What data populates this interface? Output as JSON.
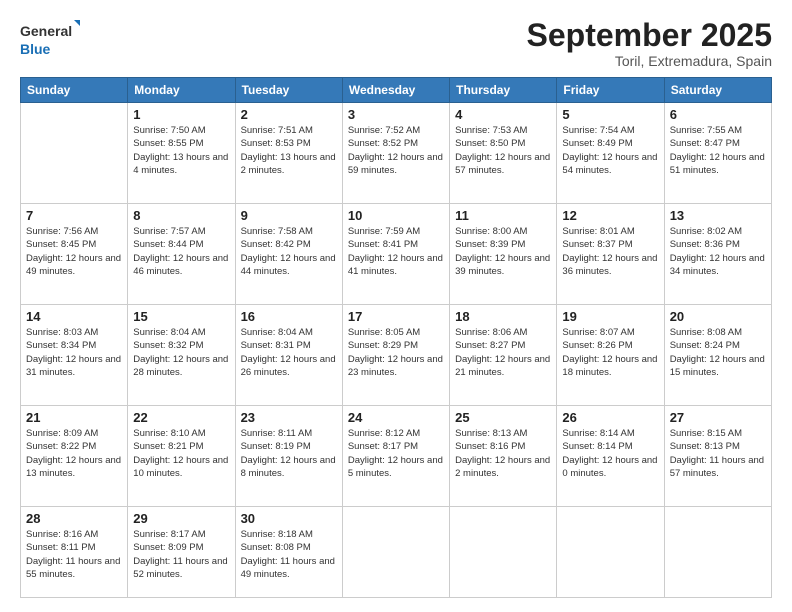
{
  "logo": {
    "line1": "General",
    "line2": "Blue"
  },
  "title": "September 2025",
  "location": "Toril, Extremadura, Spain",
  "weekdays": [
    "Sunday",
    "Monday",
    "Tuesday",
    "Wednesday",
    "Thursday",
    "Friday",
    "Saturday"
  ],
  "weeks": [
    [
      {
        "day": "",
        "sunrise": "",
        "sunset": "",
        "daylight": ""
      },
      {
        "day": "1",
        "sunrise": "Sunrise: 7:50 AM",
        "sunset": "Sunset: 8:55 PM",
        "daylight": "Daylight: 13 hours and 4 minutes."
      },
      {
        "day": "2",
        "sunrise": "Sunrise: 7:51 AM",
        "sunset": "Sunset: 8:53 PM",
        "daylight": "Daylight: 13 hours and 2 minutes."
      },
      {
        "day": "3",
        "sunrise": "Sunrise: 7:52 AM",
        "sunset": "Sunset: 8:52 PM",
        "daylight": "Daylight: 12 hours and 59 minutes."
      },
      {
        "day": "4",
        "sunrise": "Sunrise: 7:53 AM",
        "sunset": "Sunset: 8:50 PM",
        "daylight": "Daylight: 12 hours and 57 minutes."
      },
      {
        "day": "5",
        "sunrise": "Sunrise: 7:54 AM",
        "sunset": "Sunset: 8:49 PM",
        "daylight": "Daylight: 12 hours and 54 minutes."
      },
      {
        "day": "6",
        "sunrise": "Sunrise: 7:55 AM",
        "sunset": "Sunset: 8:47 PM",
        "daylight": "Daylight: 12 hours and 51 minutes."
      }
    ],
    [
      {
        "day": "7",
        "sunrise": "Sunrise: 7:56 AM",
        "sunset": "Sunset: 8:45 PM",
        "daylight": "Daylight: 12 hours and 49 minutes."
      },
      {
        "day": "8",
        "sunrise": "Sunrise: 7:57 AM",
        "sunset": "Sunset: 8:44 PM",
        "daylight": "Daylight: 12 hours and 46 minutes."
      },
      {
        "day": "9",
        "sunrise": "Sunrise: 7:58 AM",
        "sunset": "Sunset: 8:42 PM",
        "daylight": "Daylight: 12 hours and 44 minutes."
      },
      {
        "day": "10",
        "sunrise": "Sunrise: 7:59 AM",
        "sunset": "Sunset: 8:41 PM",
        "daylight": "Daylight: 12 hours and 41 minutes."
      },
      {
        "day": "11",
        "sunrise": "Sunrise: 8:00 AM",
        "sunset": "Sunset: 8:39 PM",
        "daylight": "Daylight: 12 hours and 39 minutes."
      },
      {
        "day": "12",
        "sunrise": "Sunrise: 8:01 AM",
        "sunset": "Sunset: 8:37 PM",
        "daylight": "Daylight: 12 hours and 36 minutes."
      },
      {
        "day": "13",
        "sunrise": "Sunrise: 8:02 AM",
        "sunset": "Sunset: 8:36 PM",
        "daylight": "Daylight: 12 hours and 34 minutes."
      }
    ],
    [
      {
        "day": "14",
        "sunrise": "Sunrise: 8:03 AM",
        "sunset": "Sunset: 8:34 PM",
        "daylight": "Daylight: 12 hours and 31 minutes."
      },
      {
        "day": "15",
        "sunrise": "Sunrise: 8:04 AM",
        "sunset": "Sunset: 8:32 PM",
        "daylight": "Daylight: 12 hours and 28 minutes."
      },
      {
        "day": "16",
        "sunrise": "Sunrise: 8:04 AM",
        "sunset": "Sunset: 8:31 PM",
        "daylight": "Daylight: 12 hours and 26 minutes."
      },
      {
        "day": "17",
        "sunrise": "Sunrise: 8:05 AM",
        "sunset": "Sunset: 8:29 PM",
        "daylight": "Daylight: 12 hours and 23 minutes."
      },
      {
        "day": "18",
        "sunrise": "Sunrise: 8:06 AM",
        "sunset": "Sunset: 8:27 PM",
        "daylight": "Daylight: 12 hours and 21 minutes."
      },
      {
        "day": "19",
        "sunrise": "Sunrise: 8:07 AM",
        "sunset": "Sunset: 8:26 PM",
        "daylight": "Daylight: 12 hours and 18 minutes."
      },
      {
        "day": "20",
        "sunrise": "Sunrise: 8:08 AM",
        "sunset": "Sunset: 8:24 PM",
        "daylight": "Daylight: 12 hours and 15 minutes."
      }
    ],
    [
      {
        "day": "21",
        "sunrise": "Sunrise: 8:09 AM",
        "sunset": "Sunset: 8:22 PM",
        "daylight": "Daylight: 12 hours and 13 minutes."
      },
      {
        "day": "22",
        "sunrise": "Sunrise: 8:10 AM",
        "sunset": "Sunset: 8:21 PM",
        "daylight": "Daylight: 12 hours and 10 minutes."
      },
      {
        "day": "23",
        "sunrise": "Sunrise: 8:11 AM",
        "sunset": "Sunset: 8:19 PM",
        "daylight": "Daylight: 12 hours and 8 minutes."
      },
      {
        "day": "24",
        "sunrise": "Sunrise: 8:12 AM",
        "sunset": "Sunset: 8:17 PM",
        "daylight": "Daylight: 12 hours and 5 minutes."
      },
      {
        "day": "25",
        "sunrise": "Sunrise: 8:13 AM",
        "sunset": "Sunset: 8:16 PM",
        "daylight": "Daylight: 12 hours and 2 minutes."
      },
      {
        "day": "26",
        "sunrise": "Sunrise: 8:14 AM",
        "sunset": "Sunset: 8:14 PM",
        "daylight": "Daylight: 12 hours and 0 minutes."
      },
      {
        "day": "27",
        "sunrise": "Sunrise: 8:15 AM",
        "sunset": "Sunset: 8:13 PM",
        "daylight": "Daylight: 11 hours and 57 minutes."
      }
    ],
    [
      {
        "day": "28",
        "sunrise": "Sunrise: 8:16 AM",
        "sunset": "Sunset: 8:11 PM",
        "daylight": "Daylight: 11 hours and 55 minutes."
      },
      {
        "day": "29",
        "sunrise": "Sunrise: 8:17 AM",
        "sunset": "Sunset: 8:09 PM",
        "daylight": "Daylight: 11 hours and 52 minutes."
      },
      {
        "day": "30",
        "sunrise": "Sunrise: 8:18 AM",
        "sunset": "Sunset: 8:08 PM",
        "daylight": "Daylight: 11 hours and 49 minutes."
      },
      {
        "day": "",
        "sunrise": "",
        "sunset": "",
        "daylight": ""
      },
      {
        "day": "",
        "sunrise": "",
        "sunset": "",
        "daylight": ""
      },
      {
        "day": "",
        "sunrise": "",
        "sunset": "",
        "daylight": ""
      },
      {
        "day": "",
        "sunrise": "",
        "sunset": "",
        "daylight": ""
      }
    ]
  ]
}
